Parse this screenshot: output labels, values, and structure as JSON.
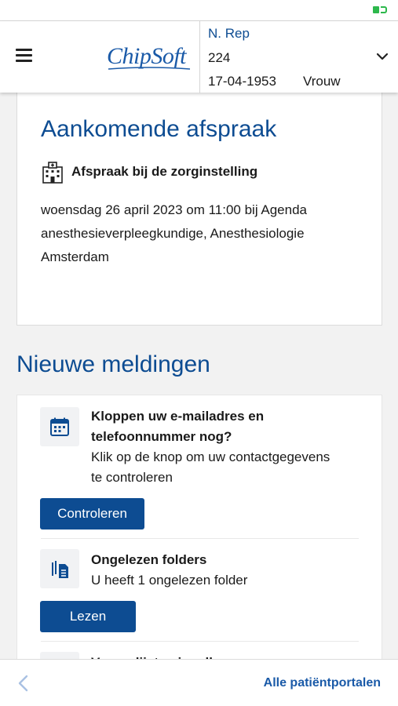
{
  "status_bar": {
    "battery_icon": "battery-charging-icon",
    "battery_color": "#2db84c"
  },
  "header": {
    "menu_icon": "hamburger-menu-icon",
    "logo_text": "ChipSoft",
    "patient": {
      "name": "N. Rep",
      "id": "224",
      "dob": "17-04-1953",
      "gender": "Vrouw"
    },
    "expand_icon": "chevron-down-icon"
  },
  "appointment": {
    "title": "Aankomende afspraak",
    "icon": "hospital-icon",
    "subtitle": "Afspraak bij de zorginstelling",
    "description": "woensdag 26 april 2023 om 11:00 bij Agenda anesthesieverpleegkundige, Anesthesiologie Amsterdam"
  },
  "notifications": {
    "title": "Nieuwe meldingen",
    "items": [
      {
        "icon": "calendar-icon",
        "title_line1": "Kloppen uw e-mailadres en",
        "title_line2": "telefoonnummer nog?",
        "text_line1": "Klik op de knop om uw contactgegevens",
        "text_line2": "te controleren",
        "button": "Controleren"
      },
      {
        "icon": "documents-icon",
        "title_line1": "Ongelezen folders",
        "text_line1": "U heeft 1 ongelezen folder",
        "button": "Lezen"
      },
      {
        "icon": "questionnaire-icon",
        "title_line1": "Vragenlijsten invullen"
      }
    ]
  },
  "bottom_bar": {
    "back_icon": "chevron-left-icon",
    "link": "Alle patiëntportalen"
  },
  "colors": {
    "primary": "#0d4c92",
    "link": "#1a5aa8",
    "background": "#f2f2f2"
  }
}
